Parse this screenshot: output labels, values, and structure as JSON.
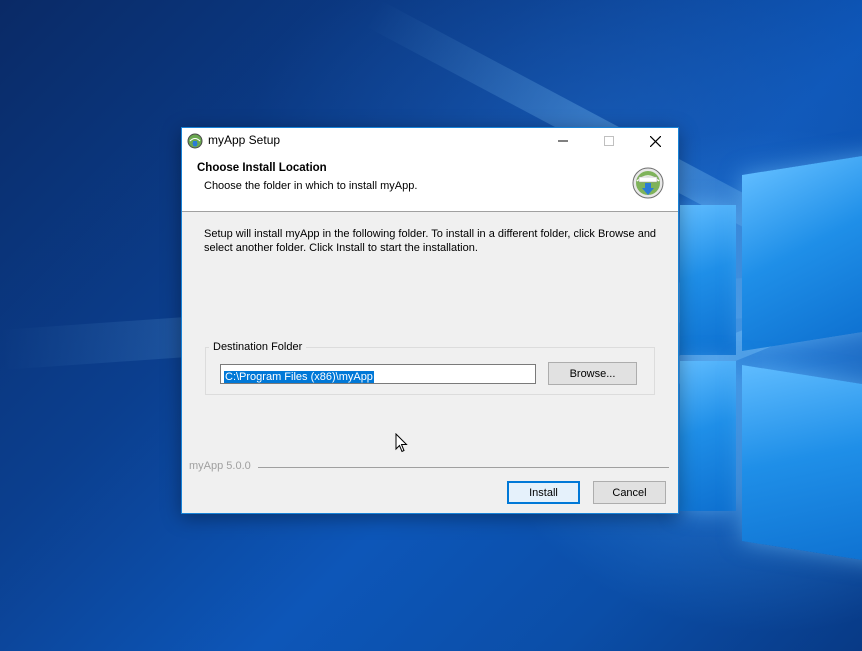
{
  "window": {
    "title": "myApp Setup"
  },
  "header": {
    "title": "Choose Install Location",
    "subtitle": "Choose the folder in which to install myApp."
  },
  "body": {
    "description": "Setup will install myApp in the following folder. To install in a different folder, click Browse and select another folder. Click Install to start the installation."
  },
  "destination": {
    "group_label": "Destination Folder",
    "path_value": "C:\\Program Files (x86)\\myApp",
    "browse_label": "Browse..."
  },
  "footer": {
    "version_label": "myApp 5.0.0",
    "install_label": "Install",
    "cancel_label": "Cancel"
  },
  "icons": {
    "app_icon": "installer-globe-icon",
    "header_icon": "installer-globe-icon",
    "minimize": "minimize-icon",
    "maximize": "maximize-icon",
    "close": "close-icon",
    "cursor": "mouse-pointer-icon"
  },
  "colors": {
    "accent": "#0078d7",
    "window_border": "#1883d7",
    "selection": "#0078d7"
  }
}
